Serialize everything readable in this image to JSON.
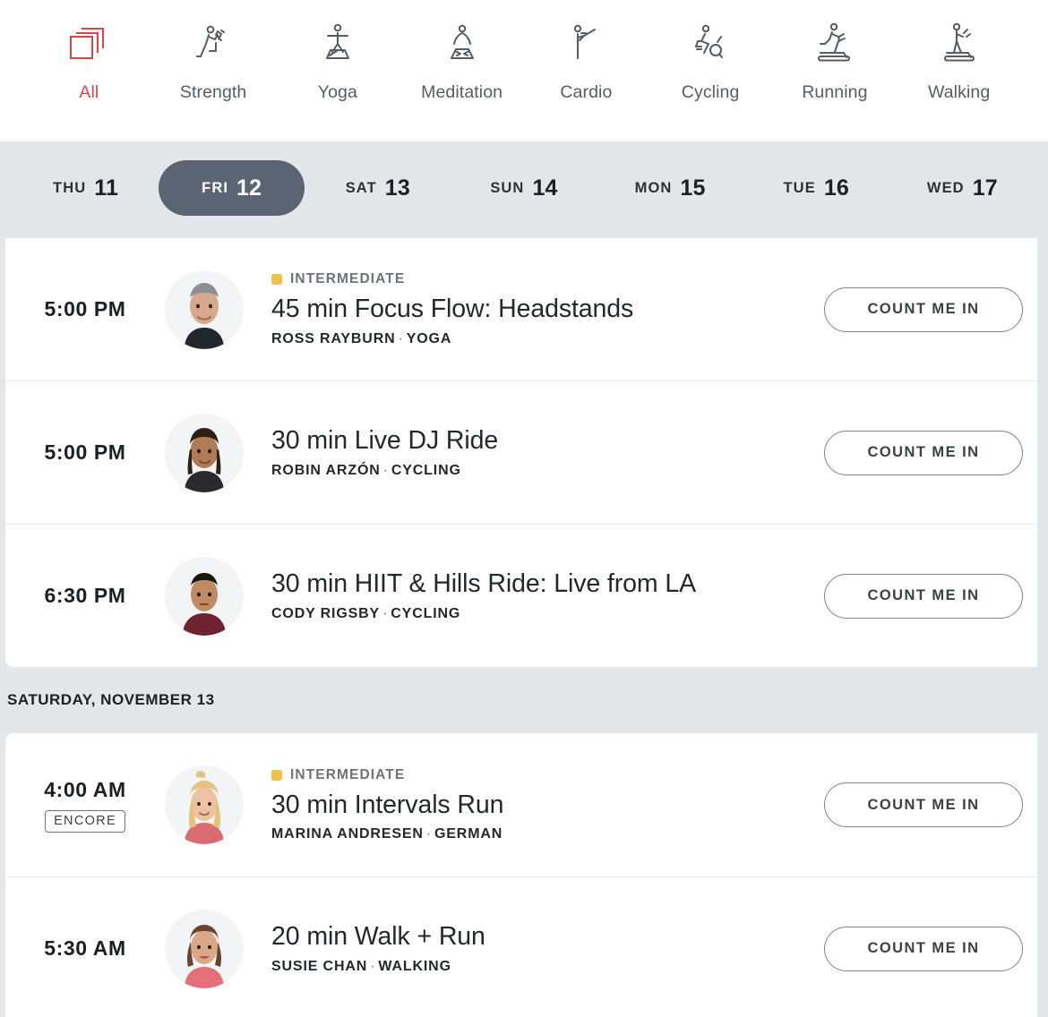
{
  "categories": [
    {
      "label": "All",
      "icon": "stack-icon",
      "active": true
    },
    {
      "label": "Strength",
      "icon": "strength-icon",
      "active": false
    },
    {
      "label": "Yoga",
      "icon": "yoga-icon",
      "active": false
    },
    {
      "label": "Meditation",
      "icon": "meditation-icon",
      "active": false
    },
    {
      "label": "Cardio",
      "icon": "cardio-icon",
      "active": false
    },
    {
      "label": "Cycling",
      "icon": "cycling-icon",
      "active": false
    },
    {
      "label": "Running",
      "icon": "running-icon",
      "active": false
    },
    {
      "label": "Walking",
      "icon": "walking-icon",
      "active": false
    }
  ],
  "dates": [
    {
      "dow": "THU",
      "num": "11",
      "selected": false
    },
    {
      "dow": "FRI",
      "num": "12",
      "selected": true
    },
    {
      "dow": "SAT",
      "num": "13",
      "selected": false
    },
    {
      "dow": "SUN",
      "num": "14",
      "selected": false
    },
    {
      "dow": "MON",
      "num": "15",
      "selected": false
    },
    {
      "dow": "TUE",
      "num": "16",
      "selected": false
    },
    {
      "dow": "WED",
      "num": "17",
      "selected": false
    }
  ],
  "colors": {
    "accent_red": "#CE4B4B",
    "selected_pill": "#5A6472",
    "difficulty_intermediate": "#EFC24B",
    "page_background": "#E4E7EA",
    "card_background": "#FFFFFF"
  },
  "cta_label": "COUNT ME IN",
  "sections": [
    {
      "header": null,
      "rows": [
        {
          "time": "5:00 PM",
          "encore": null,
          "difficulty": "INTERMEDIATE",
          "title": "45 min Focus Flow: Headstands",
          "instructor": "ROSS RAYBURN",
          "discipline": "YOGA",
          "avatar": "ross-rayburn-avatar",
          "cta": "COUNT ME IN"
        },
        {
          "time": "5:00 PM",
          "encore": null,
          "difficulty": null,
          "title": "30 min Live DJ Ride",
          "instructor": "ROBIN ARZÓN",
          "discipline": "CYCLING",
          "avatar": "robin-arzon-avatar",
          "cta": "COUNT ME IN"
        },
        {
          "time": "6:30 PM",
          "encore": null,
          "difficulty": null,
          "title": "30 min HIIT & Hills Ride: Live from LA",
          "instructor": "CODY RIGSBY",
          "discipline": "CYCLING",
          "avatar": "cody-rigsby-avatar",
          "cta": "COUNT ME IN"
        }
      ]
    },
    {
      "header": "SATURDAY, NOVEMBER 13",
      "rows": [
        {
          "time": "4:00 AM",
          "encore": "ENCORE",
          "difficulty": "INTERMEDIATE",
          "title": "30 min Intervals Run",
          "instructor": "MARINA ANDRESEN",
          "discipline": "GERMAN",
          "avatar": "marina-andresen-avatar",
          "cta": "COUNT ME IN"
        },
        {
          "time": "5:30 AM",
          "encore": null,
          "difficulty": null,
          "title": "20 min Walk + Run",
          "instructor": "SUSIE CHAN",
          "discipline": "WALKING",
          "avatar": "susie-chan-avatar",
          "cta": "COUNT ME IN"
        }
      ]
    }
  ]
}
